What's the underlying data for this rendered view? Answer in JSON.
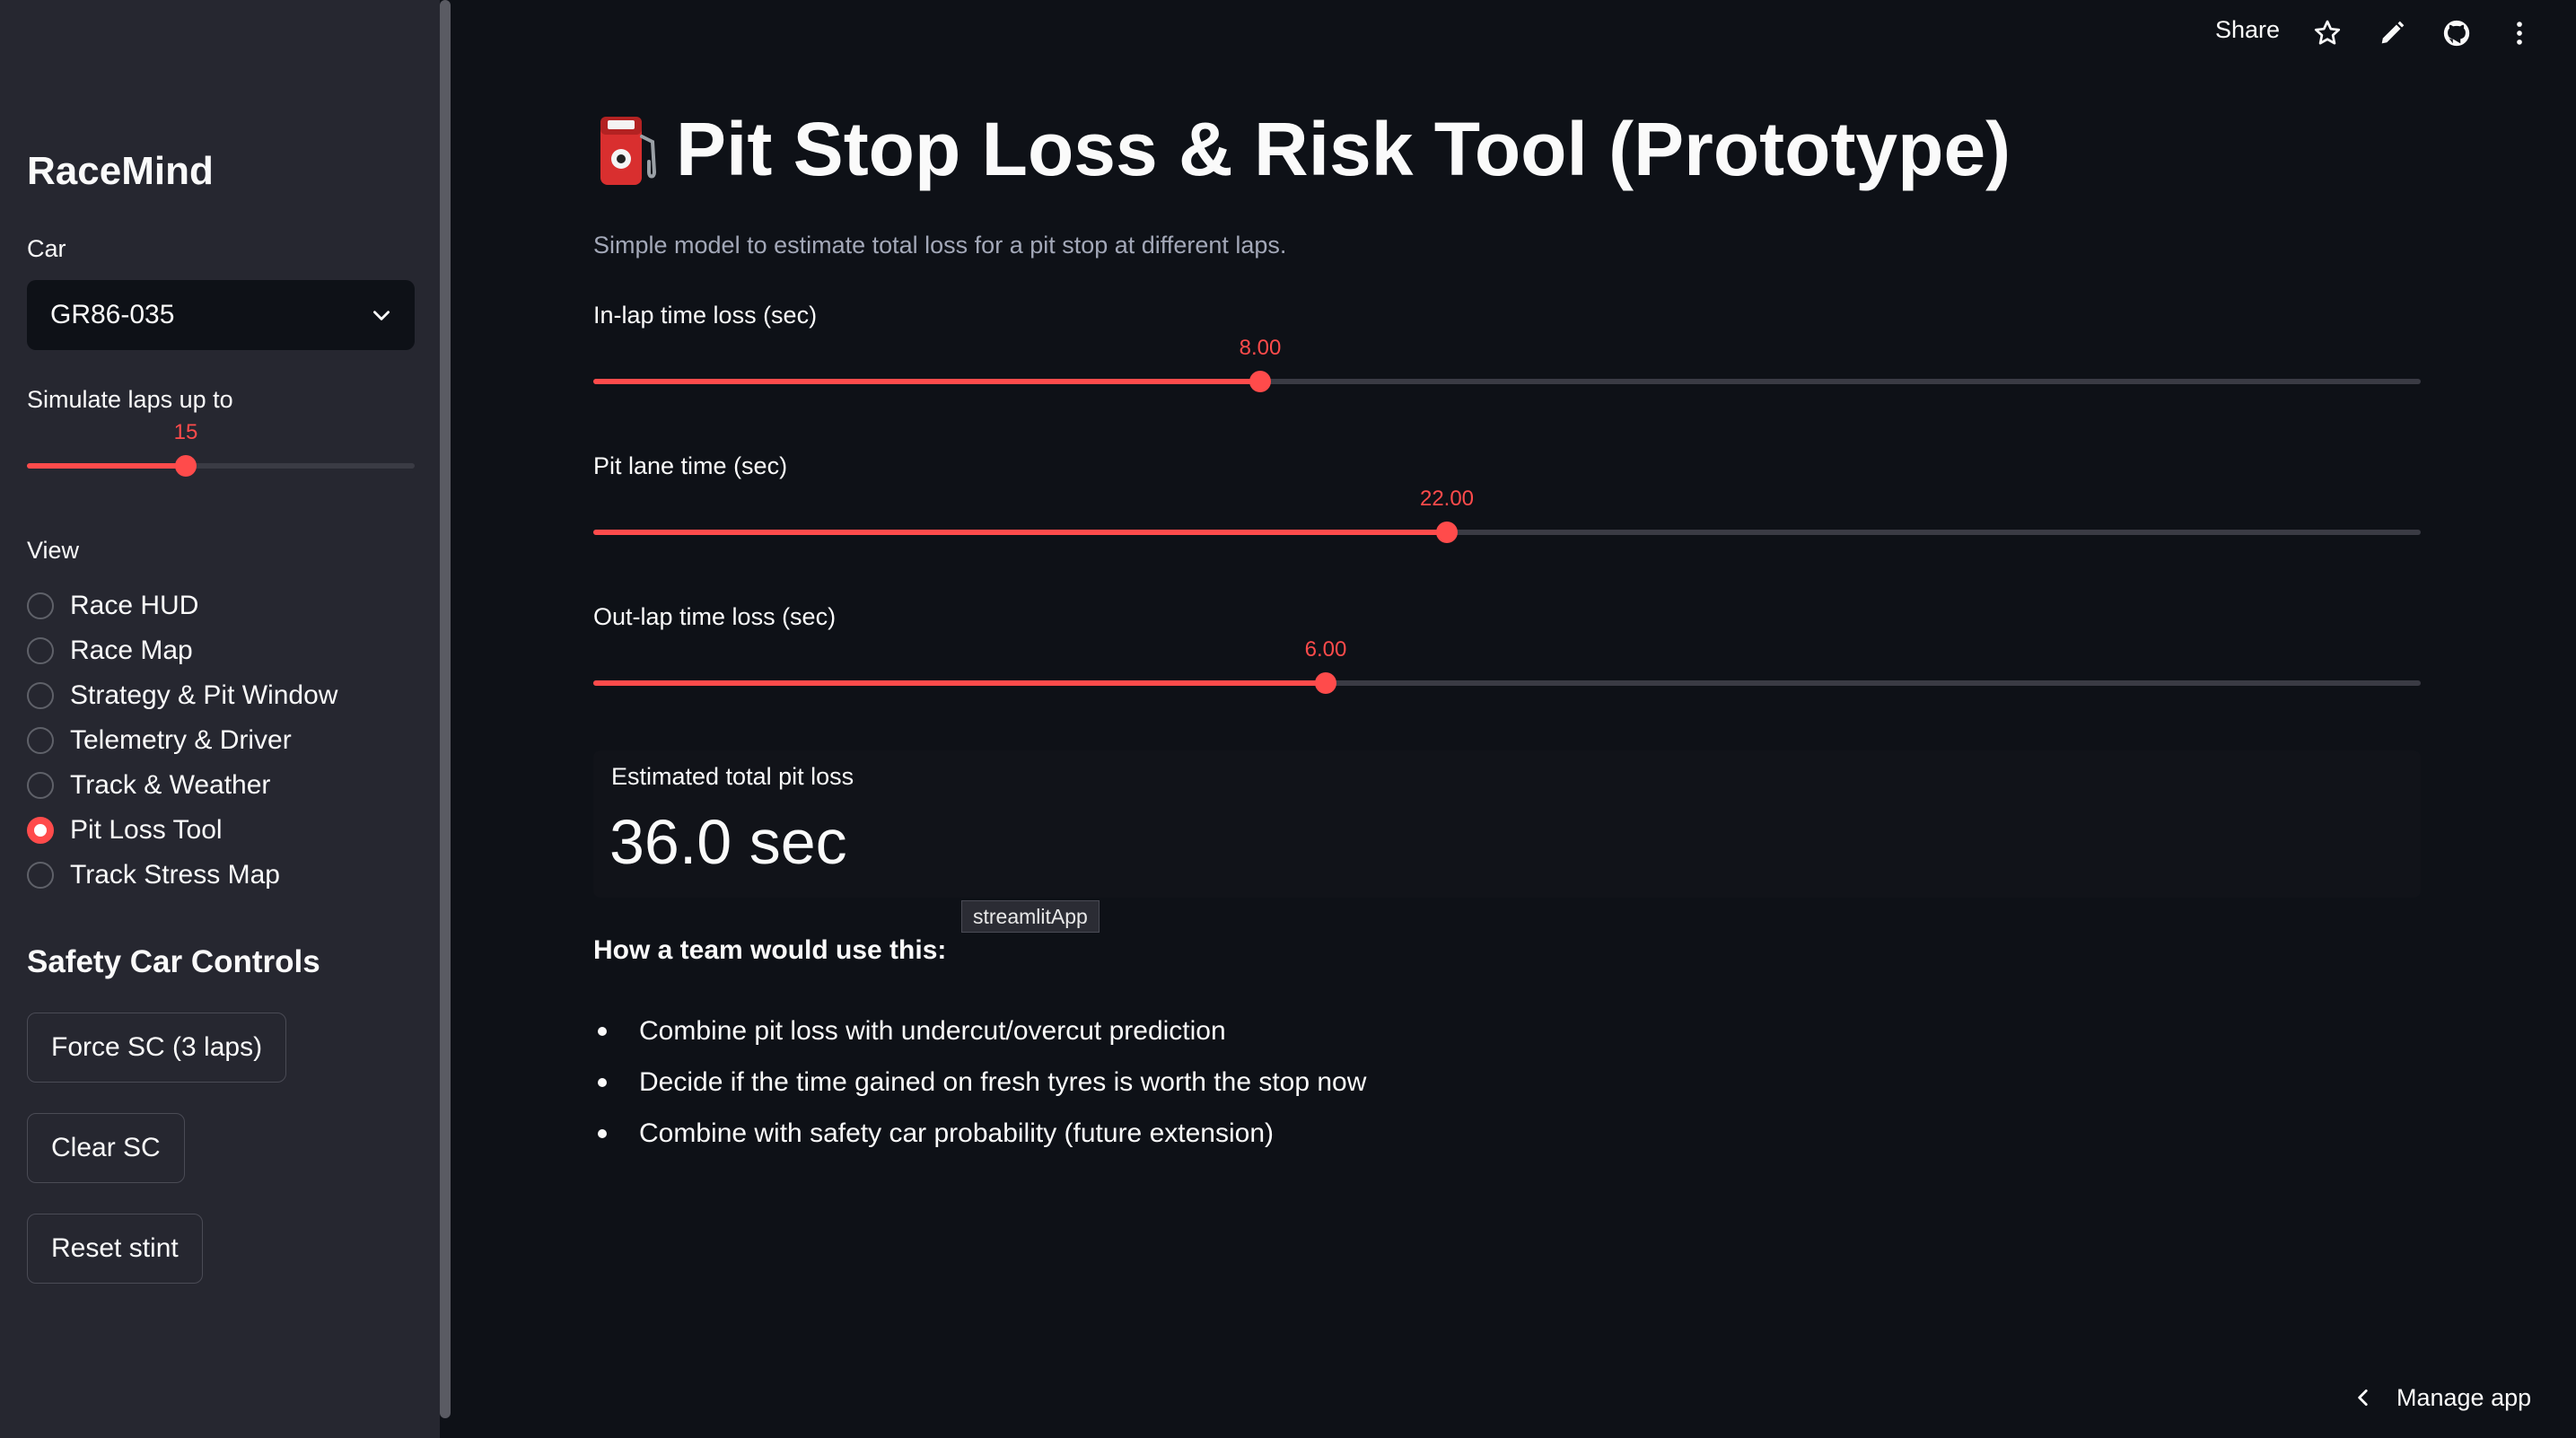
{
  "sidebar": {
    "app_title": "RaceMind",
    "car_label": "Car",
    "car_value": "GR86-035",
    "laps_label": "Simulate laps up to",
    "laps_value": "15",
    "laps_fraction": 0.41,
    "view_label": "View",
    "views": [
      {
        "label": "Race HUD",
        "selected": false
      },
      {
        "label": "Race Map",
        "selected": false
      },
      {
        "label": "Strategy & Pit Window",
        "selected": false
      },
      {
        "label": "Telemetry & Driver",
        "selected": false
      },
      {
        "label": "Track & Weather",
        "selected": false
      },
      {
        "label": "Pit Loss Tool",
        "selected": true
      },
      {
        "label": "Track Stress Map",
        "selected": false
      }
    ],
    "safety_header": "Safety Car Controls",
    "buttons": {
      "force_sc": "Force SC (3 laps)",
      "clear_sc": "Clear SC",
      "reset_stint": "Reset stint"
    }
  },
  "topbar": {
    "share_label": "Share",
    "icons": [
      "star-icon",
      "pencil-icon",
      "github-icon",
      "more-vertical-icon"
    ]
  },
  "main": {
    "title_icon": "fuel-pump-icon",
    "title": "Pit Stop Loss & Risk Tool (Prototype)",
    "subtitle": "Simple model to estimate total loss for a pit stop at different laps.",
    "sliders": [
      {
        "label": "In-lap time loss (sec)",
        "value": "8.00",
        "fraction": 0.365
      },
      {
        "label": "Pit lane time (sec)",
        "value": "22.00",
        "fraction": 0.467
      },
      {
        "label": "Out-lap time loss (sec)",
        "value": "6.00",
        "fraction": 0.401
      }
    ],
    "metric": {
      "label": "Estimated total pit loss",
      "value": "36.0 sec"
    },
    "tooltip": "streamlitApp",
    "howto_heading": "How a team would use this:",
    "bullets": [
      "Combine pit loss with undercut/overcut prediction",
      "Decide if the time gained on fresh tyres is worth the stop now",
      "Combine with safety car probability (future extension)"
    ]
  },
  "footer": {
    "manage_label": "Manage app"
  },
  "colors": {
    "accent": "#ff4b4b",
    "background": "#0e1117",
    "sidebar": "#262730"
  }
}
